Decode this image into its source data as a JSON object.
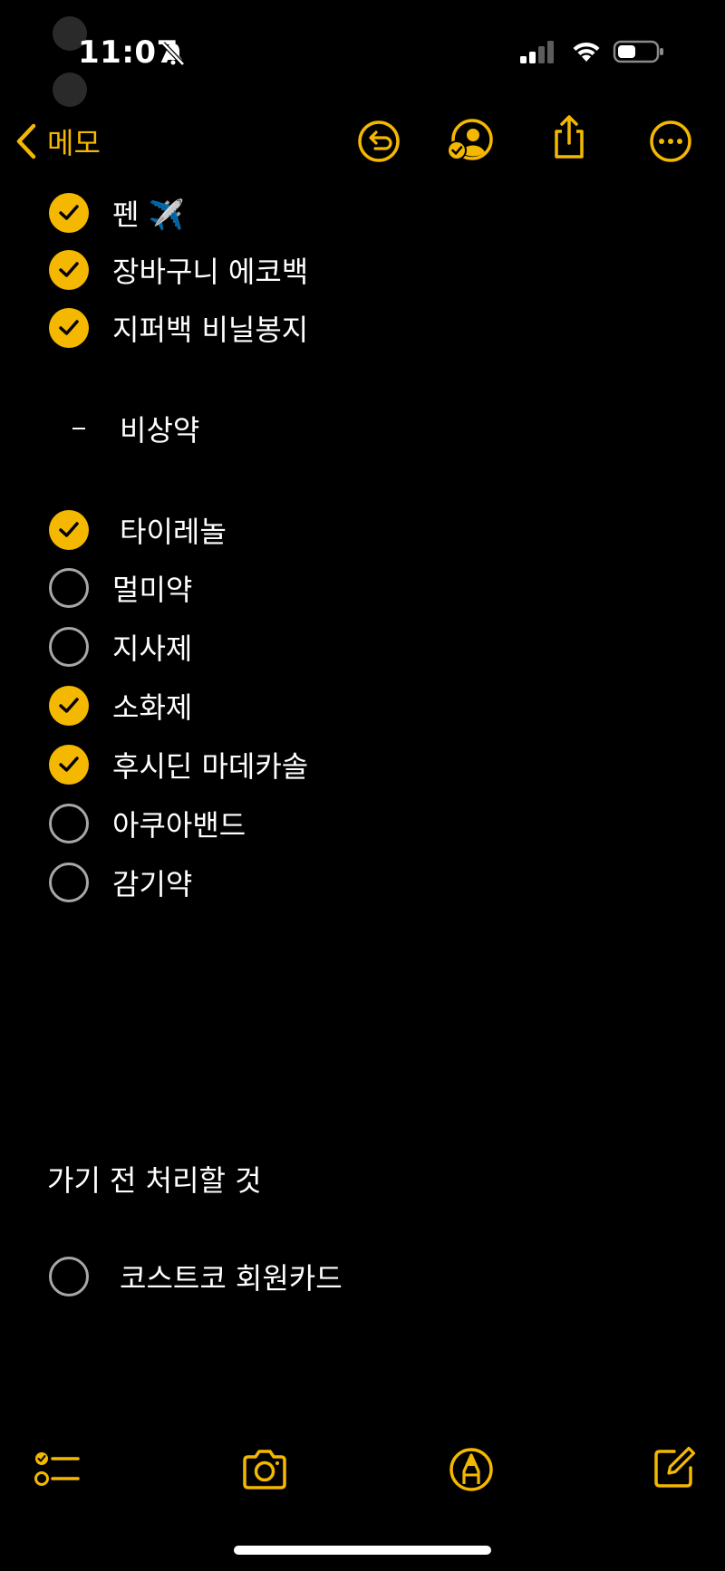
{
  "status_bar": {
    "time": "11:07"
  },
  "nav": {
    "back_label": "메모"
  },
  "checklist": [
    {
      "text": "펜 ✈️",
      "checked": true
    },
    {
      "text": "장바구니 에코백",
      "checked": true
    },
    {
      "text": "지퍼백 비닐봉지",
      "checked": true
    }
  ],
  "dash_item": "비상약",
  "medicine_list": [
    {
      "text": "타이레놀",
      "checked": true
    },
    {
      "text": "멀미약",
      "checked": false
    },
    {
      "text": "지사제",
      "checked": false
    },
    {
      "text": "소화제",
      "checked": true
    },
    {
      "text": "후시딘 마데카솔",
      "checked": true
    },
    {
      "text": "아쿠아밴드",
      "checked": false
    },
    {
      "text": "감기약",
      "checked": false
    }
  ],
  "section_heading": "가기 전 처리할 것",
  "todo_list": [
    {
      "text": "코스트코 회원카드",
      "checked": false
    }
  ],
  "colors": {
    "accent": "#F5B800",
    "background": "#000000",
    "unchecked_border": "#A7A7A7"
  },
  "icons": {
    "back": "chevron-left-icon",
    "undo": "undo-icon",
    "share_person": "collaborate-icon",
    "export": "share-icon",
    "more": "ellipsis-icon",
    "checklist": "checklist-icon",
    "camera": "camera-icon",
    "markup": "markup-pen-icon",
    "compose": "compose-icon"
  }
}
